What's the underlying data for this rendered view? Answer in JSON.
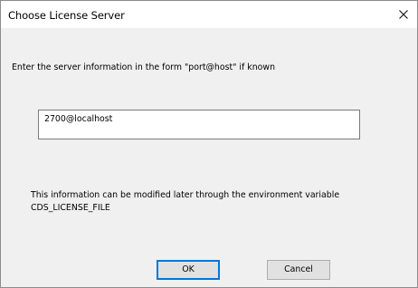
{
  "dialog": {
    "title": "Choose License Server",
    "close_icon": "close-icon"
  },
  "form": {
    "prompt": "Enter the server information in the form \"port@host\" if known",
    "server_value": "2700@localhost"
  },
  "info": {
    "line1": "This information can be modified later through the environment variable",
    "line2": "CDS_LICENSE_FILE"
  },
  "buttons": {
    "ok_label": "OK",
    "cancel_label": "Cancel"
  }
}
